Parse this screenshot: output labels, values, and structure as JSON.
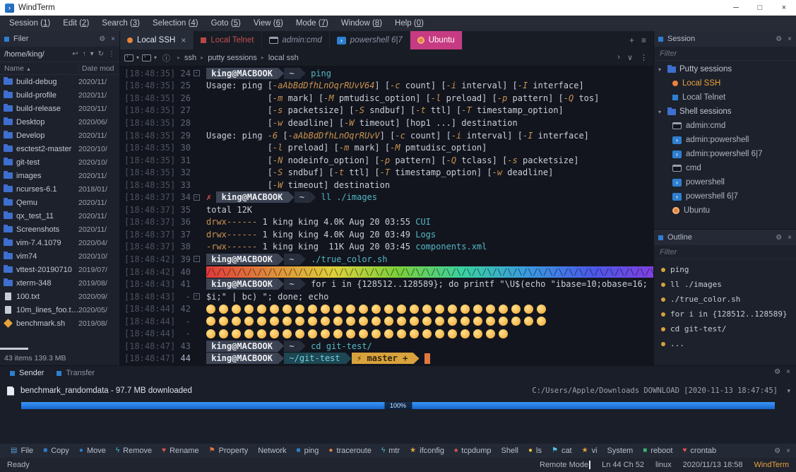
{
  "window": {
    "title": "WindTerm"
  },
  "glyphs": {
    "minimize": "─",
    "maximize": "□",
    "close": "×",
    "gear": "⚙",
    "panel_close": "×",
    "plus": "+",
    "tab_menu": "≡",
    "chevron_right": "›",
    "chevron_down": "∨",
    "more": "⋮",
    "back": "↩",
    "up": "↑",
    "dropdown": "▾",
    "refresh": "↻",
    "info": "ⓘ",
    "sort_asc": "▲",
    "crumb_sep": "▸",
    "expander": "▾"
  },
  "menu": {
    "items": [
      {
        "name": "Session",
        "key": "1"
      },
      {
        "name": "Edit",
        "key": "2"
      },
      {
        "name": "Search",
        "key": "3"
      },
      {
        "name": "Selection",
        "key": "4"
      },
      {
        "name": "Goto",
        "key": "5"
      },
      {
        "name": "View",
        "key": "6"
      },
      {
        "name": "Mode",
        "key": "7"
      },
      {
        "name": "Window",
        "key": "8"
      },
      {
        "name": "Help",
        "key": "0"
      }
    ]
  },
  "filer": {
    "title": "Filer",
    "path": "/home/king/",
    "columns": [
      "Name",
      "Date mod"
    ],
    "items": [
      {
        "name": "build-debug",
        "date": "2020/11/",
        "kind": "folder"
      },
      {
        "name": "build-profile",
        "date": "2020/11/",
        "kind": "folder"
      },
      {
        "name": "build-release",
        "date": "2020/11/",
        "kind": "folder"
      },
      {
        "name": "Desktop",
        "date": "2020/06/",
        "kind": "folder"
      },
      {
        "name": "Develop",
        "date": "2020/11/",
        "kind": "folder"
      },
      {
        "name": "esctest2-master",
        "date": "2020/10/",
        "kind": "folder"
      },
      {
        "name": "git-test",
        "date": "2020/10/",
        "kind": "folder"
      },
      {
        "name": "images",
        "date": "2020/11/",
        "kind": "folder"
      },
      {
        "name": "ncurses-6.1",
        "date": "2018/01/",
        "kind": "folder"
      },
      {
        "name": "Qemu",
        "date": "2020/11/",
        "kind": "folder"
      },
      {
        "name": "qx_test_11",
        "date": "2020/11/",
        "kind": "folder"
      },
      {
        "name": "Screenshots",
        "date": "2020/11/",
        "kind": "folder"
      },
      {
        "name": "vim-7.4.1079",
        "date": "2020/04/",
        "kind": "folder"
      },
      {
        "name": "vim74",
        "date": "2020/10/",
        "kind": "folder"
      },
      {
        "name": "vttest-20190710",
        "date": "2019/07/",
        "kind": "folder"
      },
      {
        "name": "xterm-348",
        "date": "2019/08/",
        "kind": "folder"
      },
      {
        "name": "100.txt",
        "date": "2020/09/",
        "kind": "file"
      },
      {
        "name": "10m_lines_foo.t…",
        "date": "2020/05/",
        "kind": "file"
      },
      {
        "name": "benchmark.sh",
        "date": "2019/08/",
        "kind": "script"
      }
    ],
    "status": "43 items 139.3 MB"
  },
  "tabs": [
    {
      "label": "Local SSH",
      "icon": "dot-orange",
      "state": "active",
      "close": "×"
    },
    {
      "label": "Local Telnet",
      "icon": "sq-red",
      "state": "red"
    },
    {
      "label": "admin:cmd",
      "icon": "ic-cmd",
      "state": "italic"
    },
    {
      "label": "powershell 6|7",
      "icon": "ic-ps",
      "state": "italic"
    },
    {
      "label": "Ubuntu",
      "icon": "ic-ubuntu",
      "state": "pink"
    }
  ],
  "breadcrumb": {
    "items": [
      "ssh",
      "putty sessions",
      "local ssh"
    ]
  },
  "terminal": {
    "lines": [
      {
        "ts": "[18:48:35]",
        "n": "24",
        "fold": true,
        "s": [
          {
            "k": "pb",
            "t": " king@MACBOOK "
          },
          {
            "k": "a1"
          },
          {
            "k": "ps",
            "t": " ~ "
          },
          {
            "k": "a2"
          },
          {
            "k": "cmd",
            "t": " ping"
          }
        ]
      },
      {
        "ts": "[18:48:35]",
        "n": "25",
        "s": [
          {
            "k": "w",
            "t": "Usage: ping ["
          },
          {
            "k": "f",
            "t": "-aAbBdDfhLnOqrRUvV64"
          },
          {
            "k": "w",
            "t": "] ["
          },
          {
            "k": "f",
            "t": "-c"
          },
          {
            "k": "w",
            "t": " count] ["
          },
          {
            "k": "f",
            "t": "-i"
          },
          {
            "k": "w",
            "t": " interval] ["
          },
          {
            "k": "f",
            "t": "-I"
          },
          {
            "k": "w",
            "t": " interface]"
          }
        ]
      },
      {
        "ts": "[18:48:35]",
        "n": "26",
        "s": [
          {
            "k": "w",
            "t": "            ["
          },
          {
            "k": "f",
            "t": "-m"
          },
          {
            "k": "w",
            "t": " mark] ["
          },
          {
            "k": "f",
            "t": "-M"
          },
          {
            "k": "w",
            "t": " pmtudisc_option] ["
          },
          {
            "k": "f",
            "t": "-l"
          },
          {
            "k": "w",
            "t": " preload] ["
          },
          {
            "k": "f",
            "t": "-p"
          },
          {
            "k": "w",
            "t": " pattern] ["
          },
          {
            "k": "f",
            "t": "-Q"
          },
          {
            "k": "w",
            "t": " tos]"
          }
        ]
      },
      {
        "ts": "[18:48:35]",
        "n": "27",
        "s": [
          {
            "k": "w",
            "t": "            ["
          },
          {
            "k": "f",
            "t": "-s"
          },
          {
            "k": "w",
            "t": " packetsize] ["
          },
          {
            "k": "f",
            "t": "-S"
          },
          {
            "k": "w",
            "t": " sndbuf] ["
          },
          {
            "k": "f",
            "t": "-t"
          },
          {
            "k": "w",
            "t": " ttl] ["
          },
          {
            "k": "f",
            "t": "-T"
          },
          {
            "k": "w",
            "t": " timestamp_option]"
          }
        ]
      },
      {
        "ts": "[18:48:35]",
        "n": "28",
        "s": [
          {
            "k": "w",
            "t": "            ["
          },
          {
            "k": "f",
            "t": "-w"
          },
          {
            "k": "w",
            "t": " deadline] ["
          },
          {
            "k": "f",
            "t": "-W"
          },
          {
            "k": "w",
            "t": " timeout] [hop1 ...] destination"
          }
        ]
      },
      {
        "ts": "[18:48:35]",
        "n": "29",
        "s": [
          {
            "k": "w",
            "t": "Usage: ping "
          },
          {
            "k": "f",
            "t": "-6"
          },
          {
            "k": "w",
            "t": " ["
          },
          {
            "k": "f",
            "t": "-aAbBdDfhLnOqrRUvV"
          },
          {
            "k": "w",
            "t": "] ["
          },
          {
            "k": "f",
            "t": "-c"
          },
          {
            "k": "w",
            "t": " count] ["
          },
          {
            "k": "f",
            "t": "-i"
          },
          {
            "k": "w",
            "t": " interval] ["
          },
          {
            "k": "f",
            "t": "-I"
          },
          {
            "k": "w",
            "t": " interface]"
          }
        ]
      },
      {
        "ts": "[18:48:35]",
        "n": "30",
        "s": [
          {
            "k": "w",
            "t": "            ["
          },
          {
            "k": "f",
            "t": "-l"
          },
          {
            "k": "w",
            "t": " preload] ["
          },
          {
            "k": "f",
            "t": "-m"
          },
          {
            "k": "w",
            "t": " mark] ["
          },
          {
            "k": "f",
            "t": "-M"
          },
          {
            "k": "w",
            "t": " pmtudisc_option]"
          }
        ]
      },
      {
        "ts": "[18:48:35]",
        "n": "31",
        "s": [
          {
            "k": "w",
            "t": "            ["
          },
          {
            "k": "f",
            "t": "-N"
          },
          {
            "k": "w",
            "t": " nodeinfo_option] ["
          },
          {
            "k": "f",
            "t": "-p"
          },
          {
            "k": "w",
            "t": " pattern] ["
          },
          {
            "k": "f",
            "t": "-Q"
          },
          {
            "k": "w",
            "t": " tclass] ["
          },
          {
            "k": "f",
            "t": "-s"
          },
          {
            "k": "w",
            "t": " packetsize]"
          }
        ]
      },
      {
        "ts": "[18:48:35]",
        "n": "32",
        "s": [
          {
            "k": "w",
            "t": "            ["
          },
          {
            "k": "f",
            "t": "-S"
          },
          {
            "k": "w",
            "t": " sndbuf] ["
          },
          {
            "k": "f",
            "t": "-t"
          },
          {
            "k": "w",
            "t": " ttl] ["
          },
          {
            "k": "f",
            "t": "-T"
          },
          {
            "k": "w",
            "t": " timestamp_option] ["
          },
          {
            "k": "f",
            "t": "-w"
          },
          {
            "k": "w",
            "t": " deadline]"
          }
        ]
      },
      {
        "ts": "[18:48:35]",
        "n": "33",
        "s": [
          {
            "k": "w",
            "t": "            ["
          },
          {
            "k": "f",
            "t": "-W"
          },
          {
            "k": "w",
            "t": " timeout] destination"
          }
        ]
      },
      {
        "ts": "[18:48:37]",
        "n": "34",
        "fold": true,
        "s": [
          {
            "k": "err",
            "t": "✗ "
          },
          {
            "k": "pb",
            "t": " king@MACBOOK "
          },
          {
            "k": "a1"
          },
          {
            "k": "ps",
            "t": " ~ "
          },
          {
            "k": "a2"
          },
          {
            "k": "cmd",
            "t": " ll ./images"
          }
        ]
      },
      {
        "ts": "[18:48:37]",
        "n": "35",
        "s": [
          {
            "k": "w",
            "t": "total 12K"
          }
        ]
      },
      {
        "ts": "[18:48:37]",
        "n": "36",
        "s": [
          {
            "k": "f2",
            "t": "drwx------"
          },
          {
            "k": "w",
            "t": " 1 king king 4.0K Aug 20 03:55 "
          },
          {
            "k": "cy",
            "t": "CUI"
          }
        ]
      },
      {
        "ts": "[18:48:37]",
        "n": "37",
        "s": [
          {
            "k": "f2",
            "t": "drwx------"
          },
          {
            "k": "w",
            "t": " 1 king king 4.0K Aug 20 03:49 "
          },
          {
            "k": "cy",
            "t": "Logs"
          }
        ]
      },
      {
        "ts": "[18:48:37]",
        "n": "38",
        "s": [
          {
            "k": "f2",
            "t": "-rwx------"
          },
          {
            "k": "w",
            "t": " 1 king king  11K Aug 20 03:45 "
          },
          {
            "k": "cy",
            "t": "components.xml"
          }
        ]
      },
      {
        "ts": "[18:48:42]",
        "n": "39",
        "fold": true,
        "s": [
          {
            "k": "pb",
            "t": " king@MACBOOK "
          },
          {
            "k": "a1"
          },
          {
            "k": "ps",
            "t": " ~ "
          },
          {
            "k": "a2"
          },
          {
            "k": "cmd",
            "t": " ./true_color.sh"
          }
        ]
      },
      {
        "ts": "[18:48:42]",
        "n": "40",
        "s": [
          {
            "k": "rb",
            "t": "/\\",
            "r": 45
          }
        ]
      },
      {
        "ts": "[18:48:43]",
        "n": "41",
        "s": [
          {
            "k": "pb",
            "t": " king@MACBOOK "
          },
          {
            "k": "a1"
          },
          {
            "k": "ps",
            "t": " ~ "
          },
          {
            "k": "a2"
          },
          {
            "k": "w",
            "t": " for i in {128512..128589}; do printf \"\\U$(echo \"ibase=10;obase=16;"
          }
        ]
      },
      {
        "ts": "[18:48:43]",
        "n": "-",
        "fold": true,
        "s": [
          {
            "k": "w",
            "t": "$i;\" | bc) \"; done; echo"
          }
        ]
      },
      {
        "ts": "[18:48:44]",
        "n": "42",
        "s": [
          {
            "k": "em",
            "t": "😀😁😂😃😄😅😆😇😈😉😊😋😌😍😎😏😐😑😒😓😔😕😖😗😘😙😚"
          }
        ]
      },
      {
        "ts": "[18:48:44]",
        "n": "-",
        "s": [
          {
            "k": "em",
            "t": "😛😜😝😞😟😠😡😢😣😤😥😦😧😨😩😪😫😬😭😮😯😰😱😲😳😴😵"
          }
        ]
      },
      {
        "ts": "[18:48:44]",
        "n": "-",
        "s": [
          {
            "k": "em",
            "t": "😶😷😸😹😺😻😼😽😾😿🙀🙁🙂🙃🙄🙅🙆🙇🙈🙉🙊🙋🙌🙍"
          }
        ]
      },
      {
        "ts": "[18:48:47]",
        "n": "43",
        "s": [
          {
            "k": "pb",
            "t": " king@MACBOOK "
          },
          {
            "k": "a1"
          },
          {
            "k": "ps",
            "t": " ~ "
          },
          {
            "k": "a2"
          },
          {
            "k": "cmd",
            "t": " cd git-test/"
          }
        ]
      },
      {
        "ts": "[18:48:47]",
        "n": "44",
        "current": true,
        "s": [
          {
            "k": "pb",
            "t": " king@MACBOOK "
          },
          {
            "k": "a1"
          },
          {
            "k": "gp",
            "t": " ~/git-test "
          },
          {
            "k": "a3"
          },
          {
            "k": "gb",
            "t": " ⚡ master + "
          },
          {
            "k": "a4"
          },
          {
            "k": "w",
            "t": " "
          },
          {
            "k": "cur"
          }
        ]
      }
    ]
  },
  "session_panel": {
    "title": "Session",
    "filter": "Filter",
    "groups": [
      {
        "label": "Putty sessions",
        "items": [
          {
            "label": "Local SSH",
            "icon": "dot-orange",
            "selected": true
          },
          {
            "label": "Local Telnet",
            "icon": "sq-blue"
          }
        ]
      },
      {
        "label": "Shell sessions",
        "items": [
          {
            "label": "admin:cmd",
            "icon": "ic-cmd"
          },
          {
            "label": "admin:powershell",
            "icon": "ic-ps"
          },
          {
            "label": "admin:powershell 6|7",
            "icon": "ic-ps"
          },
          {
            "label": "cmd",
            "icon": "ic-cmd"
          },
          {
            "label": "powershell",
            "icon": "ic-ps"
          },
          {
            "label": "powershell 6|7",
            "icon": "ic-ps"
          },
          {
            "label": "Ubuntu",
            "icon": "ic-ubuntu"
          }
        ]
      }
    ]
  },
  "outline_panel": {
    "title": "Outline",
    "filter": "Filter",
    "items": [
      "ping",
      "ll ./images",
      "./true_color.sh",
      "for i in {128512..128589}",
      "cd git-test/",
      "..."
    ]
  },
  "sender": {
    "tabs": [
      "Sender",
      "Transfer"
    ],
    "file": "benchmark_randomdata - 97.7 MB downloaded",
    "dest": "C:/Users/Apple/Downloads DOWNLOAD [2020-11-13 18:47:45]",
    "progress": "100%",
    "progress_value": 100
  },
  "toolbar": {
    "items": [
      {
        "label": "File",
        "glyph": "▤",
        "color": "#5b9bd5"
      },
      {
        "label": "Copy",
        "glyph": "■",
        "color": "#2e7fd0"
      },
      {
        "label": "Move",
        "glyph": "●",
        "color": "#2e7fd0"
      },
      {
        "label": "Remove",
        "glyph": "ϟ",
        "color": "#4fc3d8"
      },
      {
        "label": "Rename",
        "glyph": "♥",
        "color": "#e05555"
      },
      {
        "label": "Property",
        "glyph": "⚑",
        "color": "#e07840"
      },
      {
        "label": "Network"
      },
      {
        "label": "ping",
        "glyph": "■",
        "color": "#2e7fd0"
      },
      {
        "label": "traceroute",
        "glyph": "●",
        "color": "#e8833a"
      },
      {
        "label": "mtr",
        "glyph": "ϟ",
        "color": "#4fc3d8"
      },
      {
        "label": "ifconfig",
        "glyph": "★",
        "color": "#e8a23c"
      },
      {
        "label": "tcpdump",
        "glyph": "♠",
        "color": "#e05555"
      },
      {
        "label": "Shell"
      },
      {
        "label": "ls",
        "glyph": "●",
        "color": "#e8c33c"
      },
      {
        "label": "cat",
        "glyph": "⚑",
        "color": "#4fc3d8"
      },
      {
        "label": "vi",
        "glyph": "★",
        "color": "#e8a23c"
      },
      {
        "label": "System"
      },
      {
        "label": "reboot",
        "glyph": "■",
        "color": "#3cb371"
      },
      {
        "label": "crontab",
        "glyph": "♥",
        "color": "#e05555"
      }
    ]
  },
  "statusbar": {
    "left": "Ready",
    "mode": "Remote Mode",
    "position": "Ln 44 Ch 52",
    "os": "linux",
    "datetime": "2020/11/13 18:58",
    "app": "WindTerm"
  }
}
